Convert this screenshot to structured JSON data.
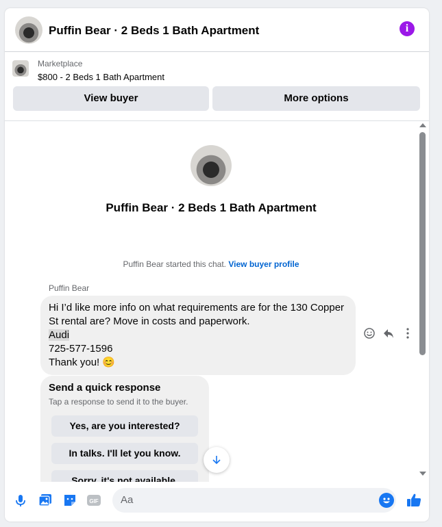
{
  "header": {
    "title": "Puffin Bear · 2 Beds 1 Bath Apartment",
    "info_icon": "info-circle-icon",
    "accent": "#9b18e8"
  },
  "listing": {
    "label": "Marketplace",
    "price_title": "$800 - 2 Beds 1 Bath Apartment",
    "view_buyer": "View buyer",
    "more_options": "More options"
  },
  "chat": {
    "title": "Puffin Bear · 2 Beds 1 Bath Apartment",
    "started_text": "Puffin Bear started this chat.",
    "started_link": "View buyer profile",
    "sender": "Puffin Bear",
    "message_lines": [
      "Hi I’d like more info on what requirements are for the 130 Copper St rental are? Move in costs and paperwork.",
      "Audi",
      "725-577-1596",
      "Thank you! 😊"
    ],
    "quick_response": {
      "title": "Send a quick response",
      "subtitle": "Tap a response to send it to the buyer.",
      "options": [
        "Yes, are you interested?",
        "In talks. I'll let you know.",
        "Sorry, it's not available."
      ]
    }
  },
  "composer": {
    "placeholder": "Aa",
    "gif_label": "GIF",
    "accent": "#1877f2"
  }
}
